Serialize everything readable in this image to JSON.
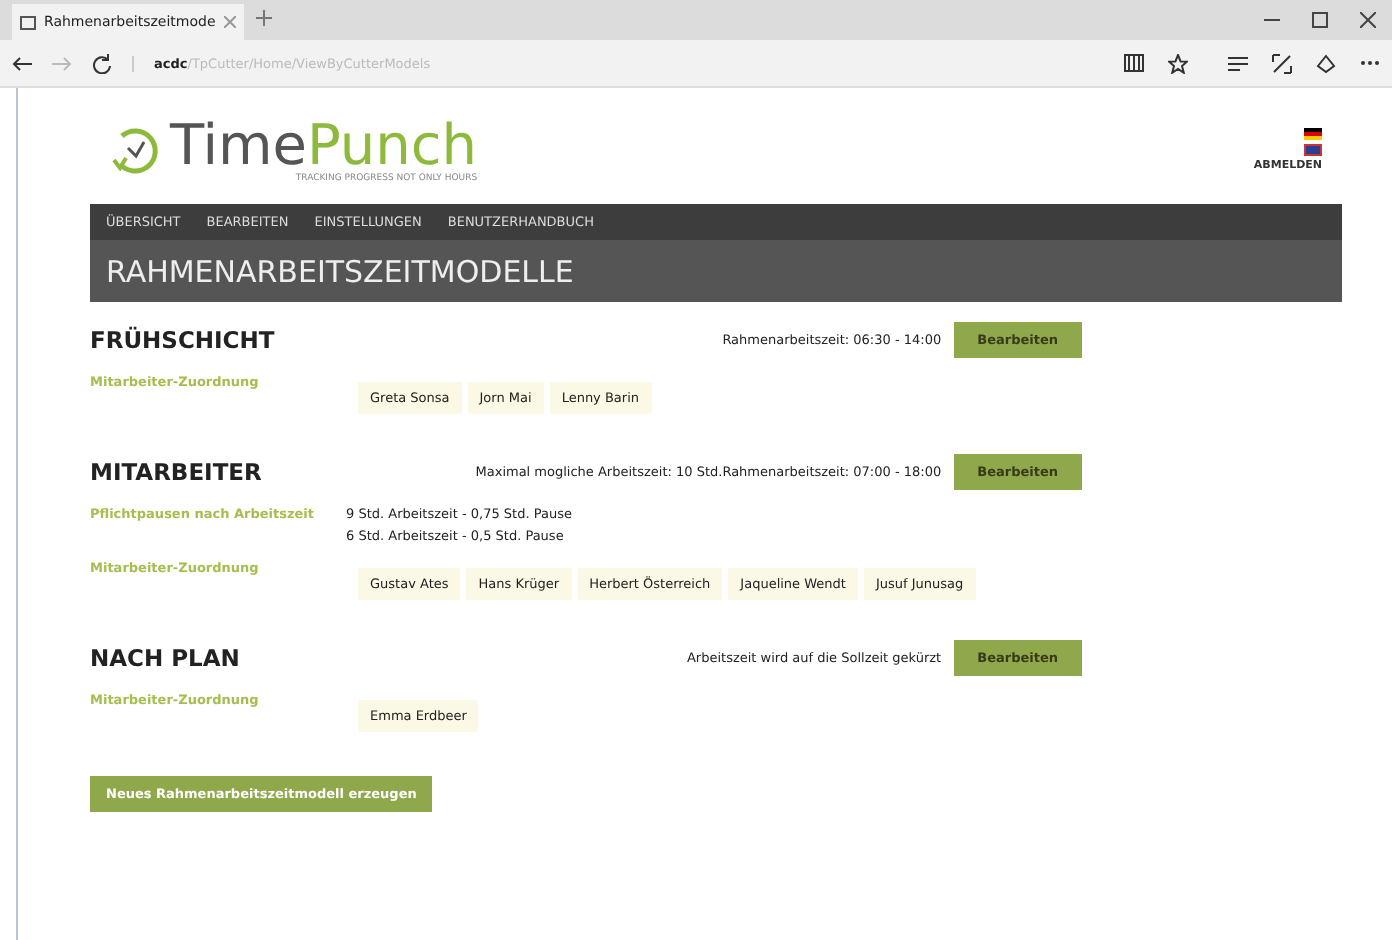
{
  "browser": {
    "tab_title": "Rahmenarbeitszeitmode",
    "address": {
      "host": "acdc",
      "path": "/TpCutter/Home/ViewByCutterModels"
    }
  },
  "header": {
    "logo": {
      "part_1": "Time",
      "part_2": "Punch",
      "tagline": "TRACKING PROGRESS NOT ONLY HOURS"
    },
    "logout": "ABMELDEN"
  },
  "nav": [
    "ÜBERSICHT",
    "BEARBEITEN",
    "EINSTELLUNGEN",
    "BENUTZERHANDBUCH"
  ],
  "page_title": "RAHMENARBEITSZEITMODELLE",
  "models": [
    {
      "name": "FRÜHSCHICHT",
      "info": "Rahmenarbeitszeit: 06:30 - 14:00",
      "button": "Bearbeiten",
      "rows": [
        {
          "kind": "chips",
          "label": "Mitarbeiter-Zuordnung",
          "items": [
            "Greta Sonsa",
            "Jorn Mai",
            "Lenny Barin"
          ]
        }
      ]
    },
    {
      "name": "MITARBEITER",
      "info": "Maximal mogliche Arbeitszeit: 10 Std.Rahmenarbeitszeit: 07:00 - 18:00",
      "button": "Bearbeiten",
      "rows": [
        {
          "kind": "lines",
          "label": "Pflichtpausen nach Arbeitszeit",
          "items": [
            "9 Std. Arbeitszeit - 0,75 Std. Pause",
            "6 Std. Arbeitszeit - 0,5 Std. Pause"
          ]
        },
        {
          "kind": "chips",
          "label": "Mitarbeiter-Zuordnung",
          "items": [
            "Gustav Ates",
            "Hans Krüger",
            "Herbert Österreich",
            "Jaqueline Wendt",
            "Jusuf Junusag"
          ]
        }
      ]
    },
    {
      "name": "NACH PLAN",
      "info": "Arbeitszeit wird auf die Sollzeit gekürzt",
      "button": "Bearbeiten",
      "rows": [
        {
          "kind": "chips",
          "label": "Mitarbeiter-Zuordnung",
          "items": [
            "Emma Erdbeer"
          ]
        }
      ]
    }
  ],
  "create_button": "Neues Rahmenarbeitszeitmodell erzeugen"
}
